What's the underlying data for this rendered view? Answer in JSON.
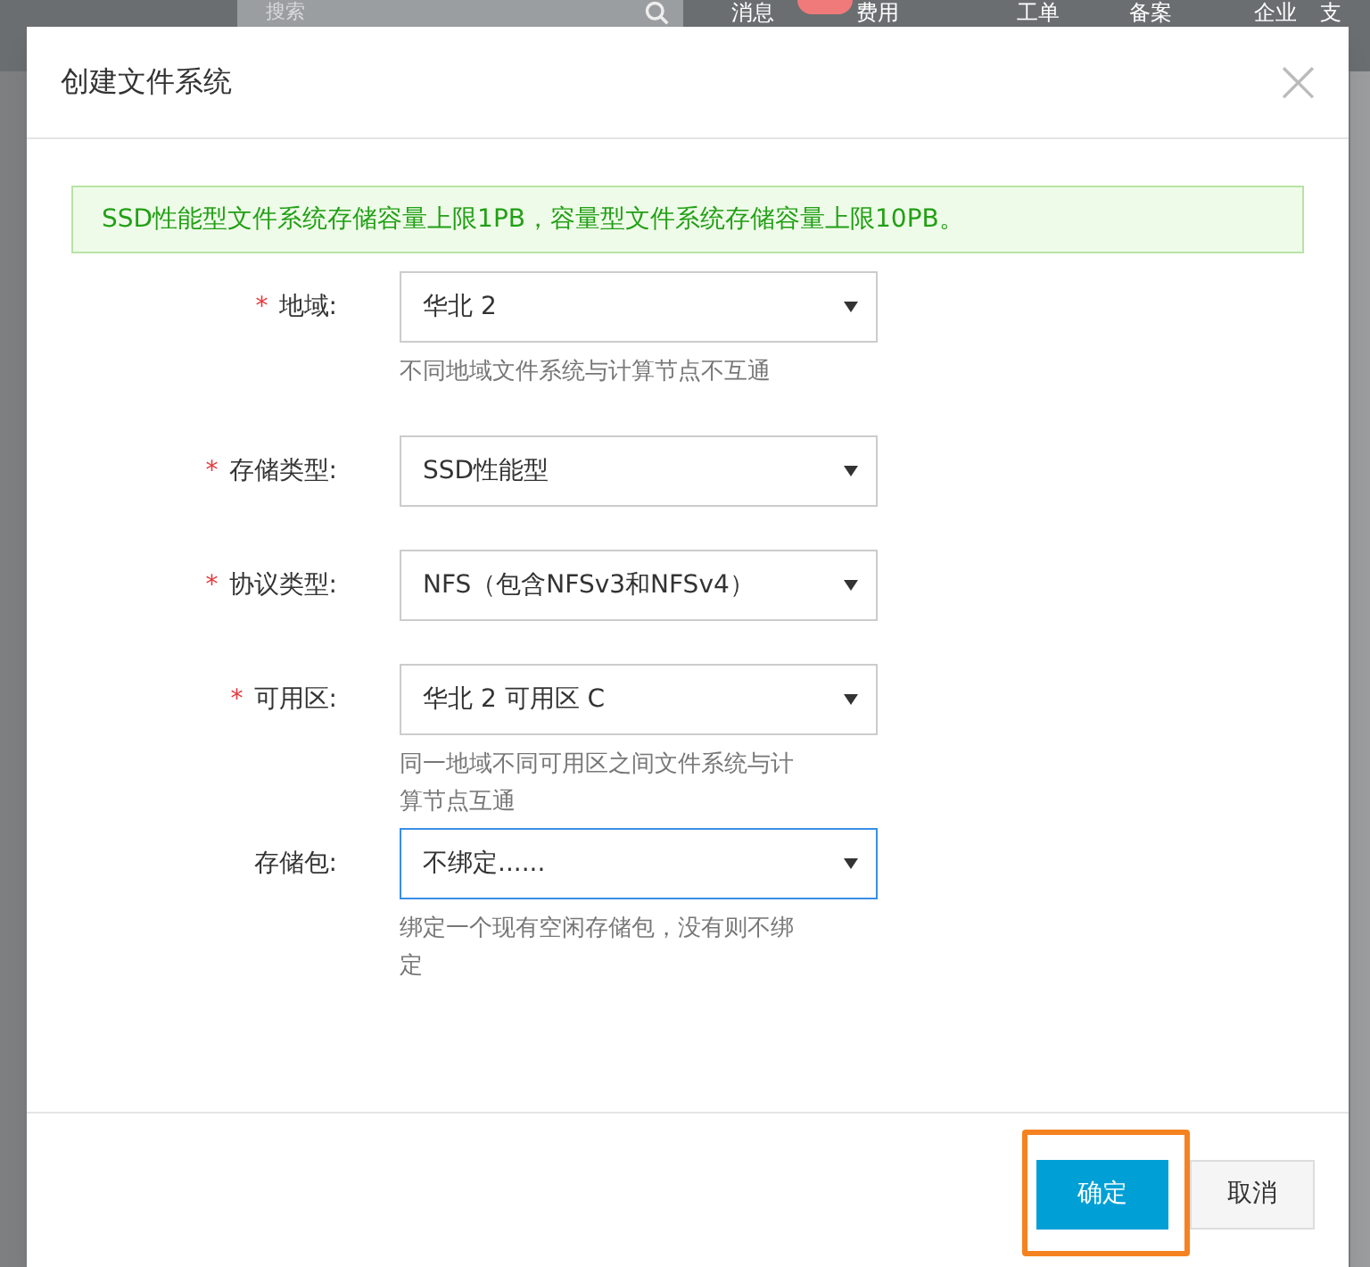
{
  "background": {
    "search_placeholder": "搜索",
    "nav": [
      "消息",
      "费用",
      "工单",
      "备案",
      "企业",
      "支"
    ]
  },
  "dialog": {
    "title": "创建文件系统",
    "close": "×",
    "notice": "SSD性能型文件系统存储容量上限1PB，容量型文件系统存储容量上限10PB。",
    "fields": [
      {
        "label": "地域:",
        "required_mark": "*",
        "value": "华北 2",
        "focused": false,
        "help": "不同地域文件系统与计算节点不互通"
      },
      {
        "label": "存储类型:",
        "required_mark": "*",
        "value": "SSD性能型",
        "focused": false
      },
      {
        "label": "协议类型:",
        "required_mark": "*",
        "value": "NFS（包含NFSv3和NFSv4）",
        "focused": false
      },
      {
        "label": "可用区:",
        "required_mark": "*",
        "value": "华北 2 可用区 C",
        "focused": false,
        "help": "同一地域不同可用区之间文件系统与计算节点互通"
      },
      {
        "label": "存储包:",
        "value": "不绑定......",
        "focused": true,
        "help": "绑定一个现有空闲存储包，没有则不绑定"
      }
    ],
    "buttons": [
      {
        "label": "确定",
        "kind": "primary",
        "highlighted": true
      },
      {
        "label": "取消",
        "kind": "secondary",
        "highlighted": false
      }
    ]
  }
}
